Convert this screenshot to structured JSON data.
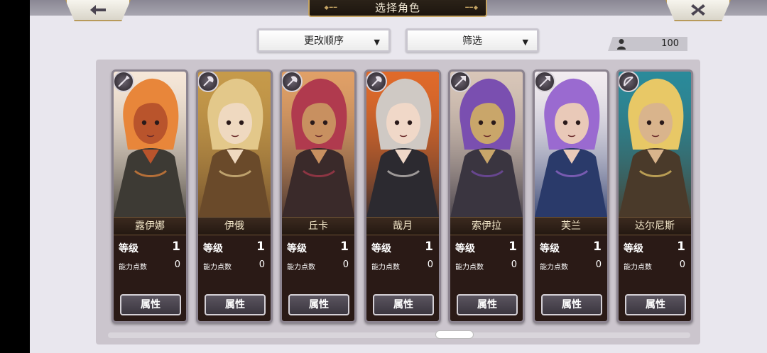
{
  "header": {
    "title": "选择角色",
    "back_icon": "back-arrow-icon",
    "close_icon": "close-x-icon"
  },
  "toolbar": {
    "sort_label": "更改顺序",
    "filter_label": "筛选",
    "caret": "▼"
  },
  "player_count": {
    "icon": "person-icon",
    "value": "100"
  },
  "labels": {
    "level": "等级",
    "ability_points": "能力点数",
    "attributes": "属性"
  },
  "colors": {
    "accent_gold": "#c6a564",
    "card_dark": "#2a1a16",
    "button_fill": "#4a4450"
  },
  "characters": [
    {
      "name": "露伊娜",
      "level": "1",
      "points": "0",
      "class_icon": "sword-icon",
      "palette": [
        "#e8863a",
        "#f6e7d8",
        "#3d3a34",
        "#b9542c"
      ]
    },
    {
      "name": "伊俄",
      "level": "1",
      "points": "0",
      "class_icon": "axe-icon",
      "palette": [
        "#e3c88a",
        "#c69a4a",
        "#6a4a2a",
        "#efd9c0"
      ]
    },
    {
      "name": "丘卡",
      "level": "1",
      "points": "0",
      "class_icon": "axe-icon",
      "palette": [
        "#b03a4e",
        "#e0a067",
        "#3a2a2a",
        "#c89060"
      ]
    },
    {
      "name": "哉月",
      "level": "1",
      "points": "0",
      "class_icon": "axe-icon",
      "palette": [
        "#cfc9c4",
        "#e06a2a",
        "#2c2a30",
        "#f0d8c8"
      ]
    },
    {
      "name": "索伊拉",
      "level": "1",
      "points": "0",
      "class_icon": "spear-icon",
      "palette": [
        "#7a4fb0",
        "#d8c6b8",
        "#3a3540",
        "#c9a66a"
      ]
    },
    {
      "name": "芙兰",
      "level": "1",
      "points": "0",
      "class_icon": "spear-icon",
      "palette": [
        "#9a6ad0",
        "#f2ecf0",
        "#2a3a6a",
        "#e9c9b8"
      ]
    },
    {
      "name": "达尔尼斯",
      "level": "1",
      "points": "0",
      "class_icon": "bow-icon",
      "palette": [
        "#e8c866",
        "#2a8a9a",
        "#4a3a2a",
        "#d9b48c"
      ]
    }
  ]
}
